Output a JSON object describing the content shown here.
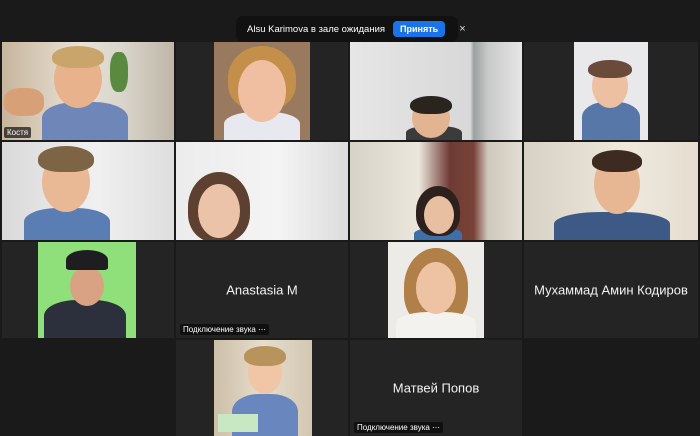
{
  "notification": {
    "message": "Alsu Karimova в зале ожидания",
    "accept_label": "Принять",
    "close_icon": "×"
  },
  "tiles": [
    {
      "name": "Костя"
    },
    {
      "name": "Anastasia M",
      "audio": "Подключение звука ⋯"
    },
    {
      "name": "Мухаммад Амин Кодиров"
    },
    {
      "name": "Матвей Попов",
      "audio": "Подключение звука ⋯"
    }
  ]
}
